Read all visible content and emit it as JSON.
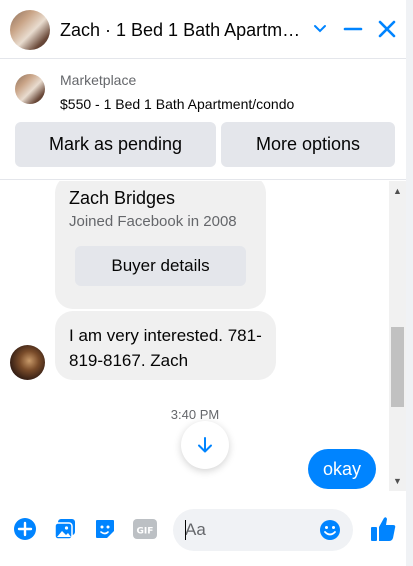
{
  "header": {
    "title": "Zach · 1 Bed 1 Bath Apartment/condo",
    "icons": [
      "chevron-down-icon",
      "minimize-icon",
      "close-icon"
    ],
    "accent_color": "#0084ff"
  },
  "marketplace": {
    "label": "Marketplace",
    "listing": "$550 - 1 Bed 1 Bath Apartment/condo",
    "actions": {
      "pending": "Mark as pending",
      "more": "More options"
    }
  },
  "buyer_card": {
    "name": "Zach Bridges",
    "joined": "Joined Facebook in 2008",
    "button": "Buyer details"
  },
  "messages": [
    {
      "from": "buyer",
      "text": "I am very interested. 781-819-8167. Zach"
    },
    {
      "from": "me",
      "text": "okay"
    }
  ],
  "timestamp": "3:40 PM",
  "composer": {
    "placeholder": "Aa",
    "icons": [
      "add-icon",
      "photo-icon",
      "sticker-icon",
      "gif-icon",
      "emoji-icon",
      "like-icon"
    ]
  }
}
